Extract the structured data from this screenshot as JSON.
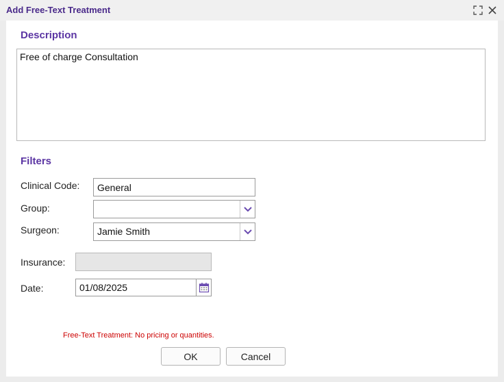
{
  "dialog": {
    "title": "Add Free-Text Treatment",
    "controls": {
      "maximize_icon": "maximize-icon",
      "close_icon": "close-icon"
    }
  },
  "description": {
    "heading": "Description",
    "value": "Free of charge Consultation"
  },
  "filters": {
    "heading": "Filters",
    "clinical_code": {
      "label": "Clinical Code:",
      "value": "General"
    },
    "group": {
      "label": "Group:",
      "value": ""
    },
    "surgeon": {
      "label": "Surgeon:",
      "value": "Jamie Smith"
    },
    "insurance": {
      "label": "Insurance:",
      "value": ""
    },
    "date": {
      "label": "Date:",
      "value": "01/08/2025"
    }
  },
  "warning": "Free-Text Treatment: No pricing or quantities.",
  "buttons": {
    "ok": "OK",
    "cancel": "Cancel"
  },
  "colors": {
    "title": "#4a2a8a",
    "heading": "#5b35a3",
    "warning": "#cc0000",
    "accent": "#6a4bb0"
  }
}
